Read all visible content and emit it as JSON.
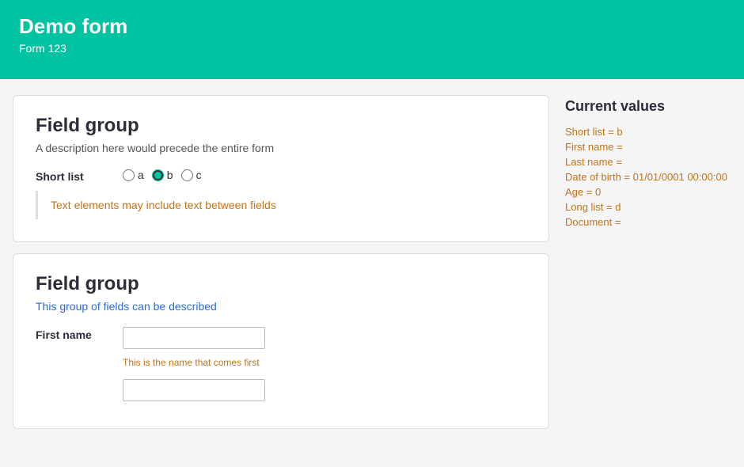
{
  "header": {
    "title": "Demo form",
    "subtitle": "Form 123"
  },
  "form": {
    "group1": {
      "title": "Field group",
      "description": "A description here would precede the entire form",
      "short_list_label": "Short list",
      "radio_options": [
        "a",
        "b",
        "c"
      ],
      "selected_radio": "b",
      "text_element": "Text elements may include text between fields"
    },
    "group2": {
      "title": "Field group",
      "description": "This group of fields can be described",
      "first_name_label": "First name",
      "first_name_value": "",
      "first_name_hint": "This is the name that comes first"
    }
  },
  "sidebar": {
    "title": "Current values",
    "items": [
      {
        "key": "Short list",
        "value": "b"
      },
      {
        "key": "First name",
        "value": ""
      },
      {
        "key": "Last name",
        "value": ""
      },
      {
        "key": "Date of birth",
        "value": "01/01/0001 00:00:00"
      },
      {
        "key": "Age",
        "value": "0"
      },
      {
        "key": "Long list",
        "value": "d"
      },
      {
        "key": "Document",
        "value": ""
      }
    ]
  }
}
